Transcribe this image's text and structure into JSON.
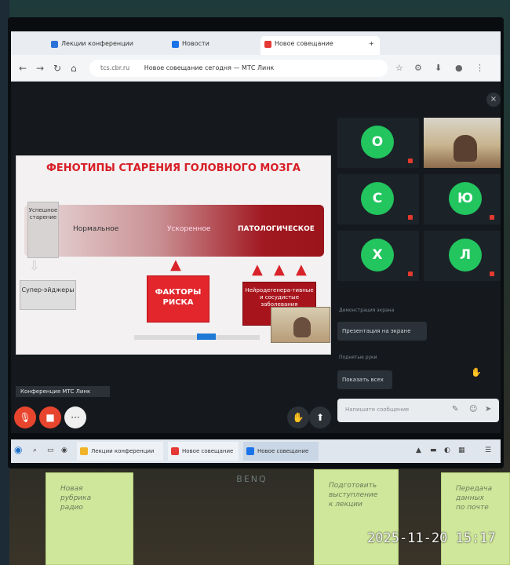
{
  "browser": {
    "tabs": [
      {
        "label": "Лекции конференции",
        "favicon_color": "#2d72d9"
      },
      {
        "label": "Новости",
        "favicon_color": "#1a73e8"
      },
      {
        "label": "Новое совещание",
        "favicon_color": "#e53935"
      }
    ],
    "tab_close": "×",
    "new_tab": "+",
    "nav": {
      "back": "←",
      "forward": "→",
      "reload": "↻",
      "home": "⌂"
    },
    "url_domain": "tcs.cbr.ru",
    "url_title": "Новое совещание сегодня — МТС Линк"
  },
  "conference": {
    "close_icon": "×",
    "slide": {
      "title": "ФЕНОТИПЫ СТАРЕНИЯ ГОЛОВНОГО МОЗГА",
      "left_box": "Успешное старение",
      "phase_normal": "Нормальное",
      "phase_accelerated": "Ускоренное",
      "phase_pathological": "ПАТОЛОГИЧЕСКОЕ",
      "super_box": "Супер-эйджеры",
      "risk_box": "ФАКТОРЫ РИСКА",
      "dx_box": "Нейродегенера-тивные и сосудистые заболевания",
      "arrow_glyph": "▲",
      "down_arrow": "⇩"
    },
    "participants": [
      {
        "initial": "О",
        "type": "avatar"
      },
      {
        "initial": "",
        "type": "video"
      },
      {
        "initial": "С",
        "type": "avatar"
      },
      {
        "initial": "Ю",
        "type": "avatar"
      },
      {
        "initial": "Х",
        "type": "avatar"
      },
      {
        "initial": "Л",
        "type": "avatar"
      }
    ],
    "side_caption_1": "Демонстрация экрана",
    "demo_button_1": "Презентация на экране",
    "side_caption_2": "Поднятые руки",
    "demo_button_2": "Показать всех",
    "chat_placeholder": "Напишите сообщение",
    "room_name": "Конференция МТС Линк",
    "controls": {
      "mic": "🎙",
      "camera": "■",
      "more": "···",
      "hand": "✋",
      "share": "⬆"
    }
  },
  "taskbar": {
    "start": "◉",
    "items": [
      {
        "label": "Лекции конференции",
        "color": "#f0b429"
      },
      {
        "label": "Новое совещание",
        "color": "#e53935"
      },
      {
        "label": "Новое совещание",
        "color": "#1a73e8"
      }
    ],
    "tray": [
      "▲",
      "▬",
      "◐",
      "▦",
      "☰"
    ]
  },
  "monitor_brand": "BENQ",
  "notes": [
    "Новая\nрубрика\nрадио",
    "Подготовить\nвыступление\nк лекции",
    "Передача\nданных\nпо почте"
  ],
  "timestamp": "2025-11-20 15:17"
}
